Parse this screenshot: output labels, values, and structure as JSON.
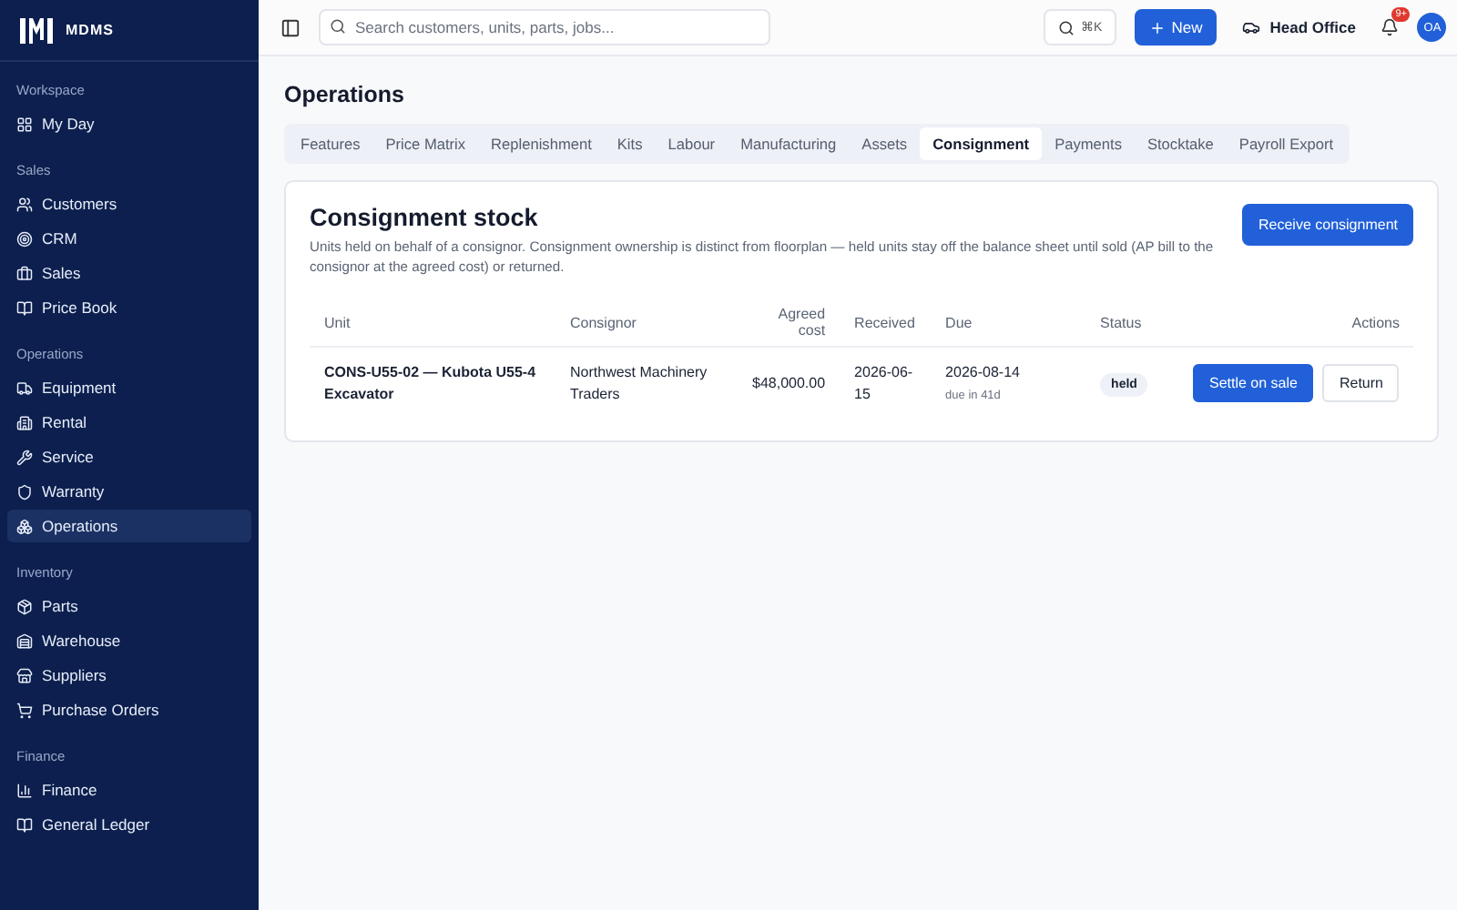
{
  "brand": {
    "name": "MDMS"
  },
  "sidebar": {
    "sections": [
      {
        "title": "Workspace",
        "items": [
          {
            "label": "My Day",
            "selected": false
          }
        ]
      },
      {
        "title": "Sales",
        "items": [
          {
            "label": "Customers",
            "selected": false
          },
          {
            "label": "CRM",
            "selected": false
          },
          {
            "label": "Sales",
            "selected": false
          },
          {
            "label": "Price Book",
            "selected": false
          }
        ]
      },
      {
        "title": "Operations",
        "items": [
          {
            "label": "Equipment",
            "selected": false
          },
          {
            "label": "Rental",
            "selected": false
          },
          {
            "label": "Service",
            "selected": false
          },
          {
            "label": "Warranty",
            "selected": false
          },
          {
            "label": "Operations",
            "selected": true
          }
        ]
      },
      {
        "title": "Inventory",
        "items": [
          {
            "label": "Parts",
            "selected": false
          },
          {
            "label": "Warehouse",
            "selected": false
          },
          {
            "label": "Suppliers",
            "selected": false
          },
          {
            "label": "Purchase Orders",
            "selected": false
          }
        ]
      },
      {
        "title": "Finance",
        "items": [
          {
            "label": "Finance",
            "selected": false
          },
          {
            "label": "General Ledger",
            "selected": false
          }
        ]
      }
    ]
  },
  "topbar": {
    "search": {
      "placeholder": "Search customers, units, parts, jobs..."
    },
    "shortcut": "⌘K",
    "new_button": "New",
    "branch": "Head Office",
    "notifications_badge": "9+",
    "avatar": "OA"
  },
  "page": {
    "title": "Operations",
    "tabs": [
      {
        "label": "Features",
        "selected": false
      },
      {
        "label": "Price Matrix",
        "selected": false
      },
      {
        "label": "Replenishment",
        "selected": false
      },
      {
        "label": "Kits",
        "selected": false
      },
      {
        "label": "Labour",
        "selected": false
      },
      {
        "label": "Manufacturing",
        "selected": false
      },
      {
        "label": "Assets",
        "selected": false
      },
      {
        "label": "Consignment",
        "selected": true
      },
      {
        "label": "Payments",
        "selected": false
      },
      {
        "label": "Stocktake",
        "selected": false
      },
      {
        "label": "Payroll Export",
        "selected": false
      }
    ],
    "card": {
      "title": "Consignment stock",
      "description": "Units held on behalf of a consignor. Consignment ownership is distinct from floorplan — held units stay off the balance sheet until sold (AP bill to the consignor at the agreed cost) or returned.",
      "action": "Receive consignment",
      "table": {
        "columns": [
          "Unit",
          "Consignor",
          "Agreed cost",
          "Received",
          "Due",
          "Status",
          "Actions"
        ],
        "rows": [
          {
            "unit": "CONS-U55-02 — Kubota U55-4 Excavator",
            "consignor": "Northwest Machinery Traders",
            "agreed_cost": "$48,000.00",
            "received": "2026-06-15",
            "due": "2026-08-14",
            "due_note": "due in 41d",
            "status": "held",
            "actions": [
              "Settle on sale",
              "Return"
            ]
          }
        ]
      }
    }
  }
}
